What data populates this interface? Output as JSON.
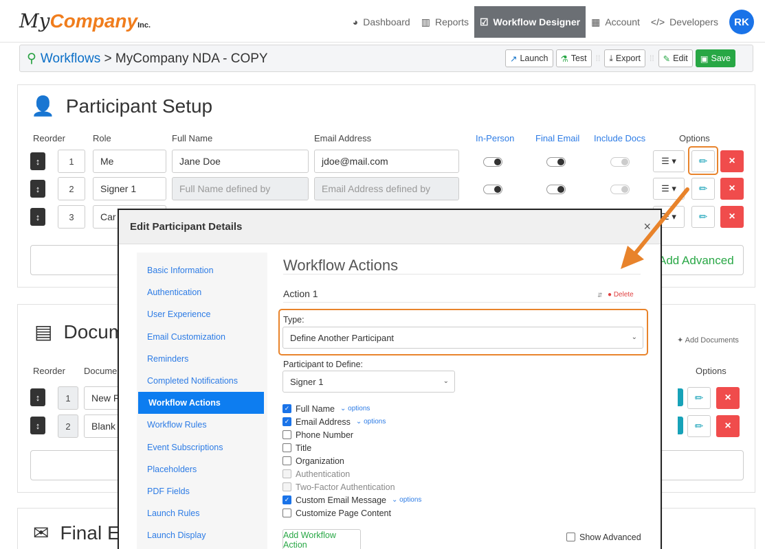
{
  "brand": {
    "logo_my": "My",
    "logo_company": "Company",
    "logo_inc": "Inc."
  },
  "nav": {
    "items": [
      {
        "label": "Dashboard",
        "icon": "dashboard-icon"
      },
      {
        "label": "Reports",
        "icon": "bar-chart-icon"
      },
      {
        "label": "Workflow Designer",
        "icon": "workflow-icon",
        "active": true
      },
      {
        "label": "Account",
        "icon": "building-icon"
      },
      {
        "label": "Developers",
        "icon": "code-icon"
      }
    ],
    "avatar": "RK"
  },
  "breadcrumb": {
    "root": "Workflows",
    "separator": ">",
    "current": "MyCompany NDA - COPY"
  },
  "toolbar": {
    "launch": "Launch",
    "test": "Test",
    "export": "Export",
    "edit": "Edit",
    "save": "Save"
  },
  "participants": {
    "title": "Participant Setup",
    "columns": {
      "reorder": "Reorder",
      "role": "Role",
      "full_name": "Full Name",
      "email": "Email Address",
      "in_person": "In-Person",
      "final_email": "Final Email",
      "include_docs": "Include Docs",
      "options": "Options"
    },
    "rows": [
      {
        "num": "1",
        "role": "Me",
        "name": "Jane Doe",
        "email": "jdoe@mail.com"
      },
      {
        "num": "2",
        "role": "Signer 1",
        "name": "Full Name defined by",
        "email": "Email Address defined by"
      },
      {
        "num": "3",
        "role": "Car"
      }
    ],
    "add_advanced": "Add Advanced"
  },
  "documents": {
    "title": "Docum",
    "columns": {
      "reorder": "Reorder",
      "document": "Documer",
      "options": "Options"
    },
    "add_documents": "Add Documents",
    "rows": [
      {
        "num": "1",
        "name": "New F"
      },
      {
        "num": "2",
        "name": "Blank"
      }
    ]
  },
  "final_email": {
    "title": "Final Er"
  },
  "modal": {
    "title": "Edit Participant Details",
    "close": "×",
    "sidebar": [
      "Basic Information",
      "Authentication",
      "User Experience",
      "Email Customization",
      "Reminders",
      "Completed Notifications",
      "Workflow Actions",
      "Workflow Rules",
      "Event Subscriptions",
      "Placeholders",
      "PDF Fields",
      "Launch Rules",
      "Launch Display"
    ],
    "active_index": 6,
    "heading": "Workflow Actions",
    "action_label": "Action 1",
    "delete_label": "Delete",
    "type_label": "Type:",
    "type_value": "Define Another Participant",
    "participant_label": "Participant to Define:",
    "participant_value": "Signer 1",
    "options_link": "options",
    "checkboxes": [
      {
        "label": "Full Name",
        "checked": true,
        "options": true
      },
      {
        "label": "Email Address",
        "checked": true,
        "options": true
      },
      {
        "label": "Phone Number",
        "checked": false
      },
      {
        "label": "Title",
        "checked": false
      },
      {
        "label": "Organization",
        "checked": false
      },
      {
        "label": "Authentication",
        "checked": false,
        "disabled": true
      },
      {
        "label": "Two-Factor Authentication",
        "checked": false,
        "disabled": true
      },
      {
        "label": "Custom Email Message",
        "checked": true,
        "options": true
      },
      {
        "label": "Customize Page Content",
        "checked": false
      }
    ],
    "add_action": "Add Workflow Action",
    "show_advanced": "Show Advanced"
  },
  "colors": {
    "accent": "#e8832b",
    "primary": "#0d7df0",
    "success": "#28a745",
    "danger": "#f04c4c"
  }
}
